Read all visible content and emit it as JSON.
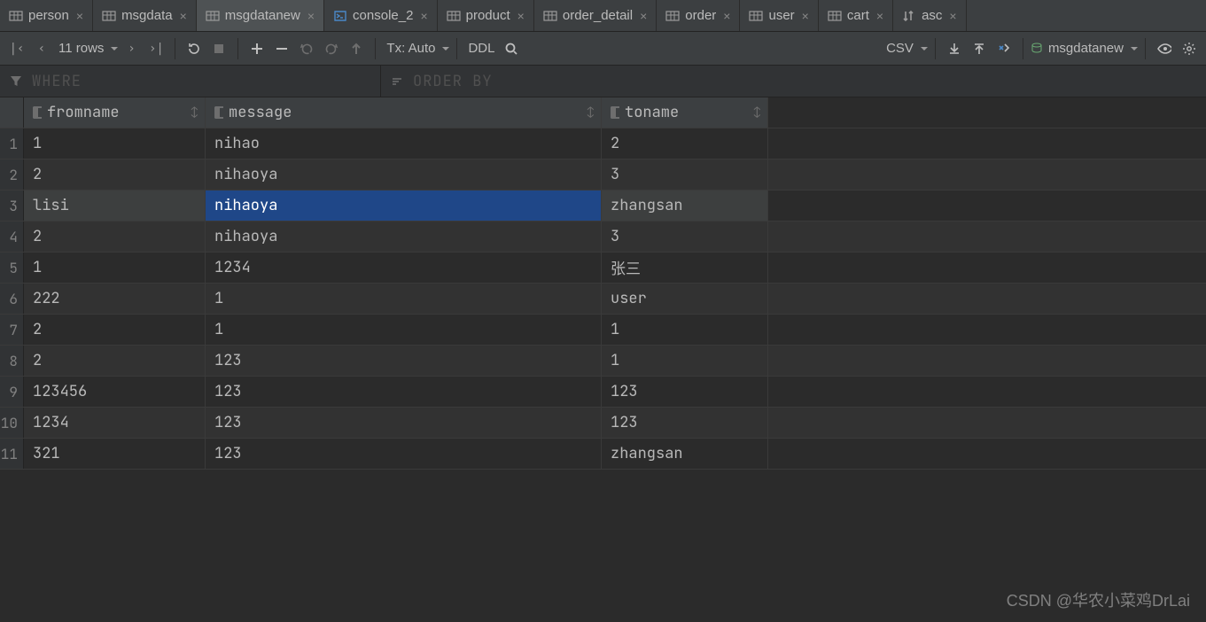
{
  "tabs": [
    {
      "icon": "table",
      "label": "person",
      "active": false
    },
    {
      "icon": "table",
      "label": "msgdata",
      "active": false
    },
    {
      "icon": "table",
      "label": "msgdatanew",
      "active": true
    },
    {
      "icon": "console",
      "label": "console_2",
      "active": false
    },
    {
      "icon": "table",
      "label": "product",
      "active": false
    },
    {
      "icon": "table",
      "label": "order_detail",
      "active": false
    },
    {
      "icon": "table",
      "label": "order",
      "active": false
    },
    {
      "icon": "table",
      "label": "user",
      "active": false
    },
    {
      "icon": "table",
      "label": "cart",
      "active": false
    },
    {
      "icon": "sort",
      "label": "asc",
      "active": false
    }
  ],
  "toolbar": {
    "rowcount": "11 rows",
    "tx": "Tx: Auto",
    "ddl": "DDL",
    "csv": "CSV",
    "dsname": "msgdatanew"
  },
  "filters": {
    "where": "WHERE",
    "orderby": "ORDER BY"
  },
  "columns": [
    "fromname",
    "message",
    "toname"
  ],
  "rows": [
    {
      "fromname": "1",
      "message": "nihao",
      "toname": "2"
    },
    {
      "fromname": "2",
      "message": "nihaoya",
      "toname": "3"
    },
    {
      "fromname": "lisi",
      "message": "nihaoya",
      "toname": "zhangsan"
    },
    {
      "fromname": "2",
      "message": "nihaoya",
      "toname": "3"
    },
    {
      "fromname": "1",
      "message": "1234",
      "toname": "张三"
    },
    {
      "fromname": "222",
      "message": "1",
      "toname": "user"
    },
    {
      "fromname": "2",
      "message": "1",
      "toname": "1"
    },
    {
      "fromname": "2",
      "message": "123",
      "toname": "1"
    },
    {
      "fromname": "123456",
      "message": "123",
      "toname": "123"
    },
    {
      "fromname": "1234",
      "message": "123",
      "toname": "123"
    },
    {
      "fromname": "321",
      "message": "123",
      "toname": "zhangsan"
    }
  ],
  "selected_row_index": 2,
  "selected_col": "message",
  "watermark": "CSDN @华农小菜鸡DrLai"
}
